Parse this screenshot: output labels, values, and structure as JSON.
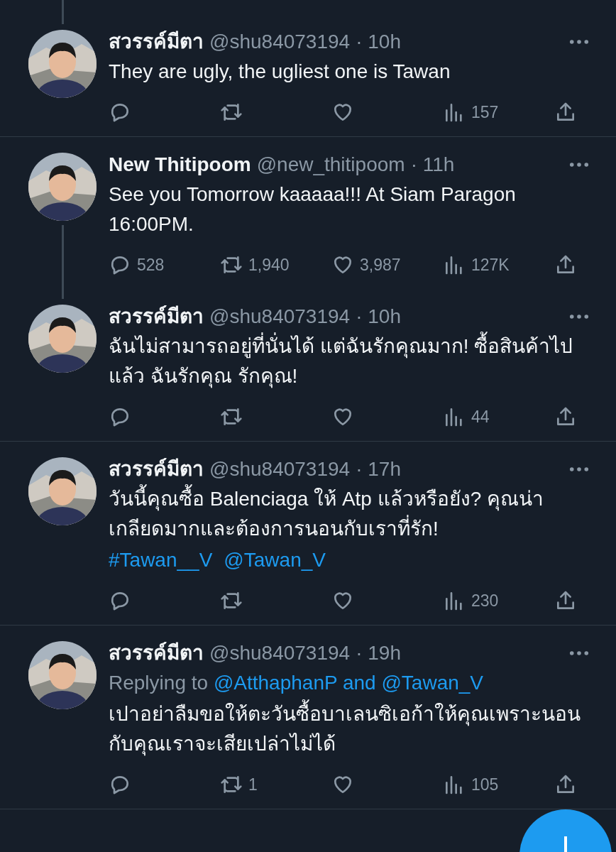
{
  "tweets": [
    {
      "name": "สวรรค์มีตา",
      "handle": "@shu84073194",
      "time": "· 10h",
      "avatar": {
        "kind": "picture"
      },
      "thread_above": true,
      "thread_below": false,
      "divider": true,
      "body": [
        [
          {
            "kind": "text",
            "text": "They are ugly, the ugliest one is Tawan"
          }
        ]
      ],
      "counts": {
        "views": "157"
      }
    },
    {
      "name": "New Thitipoom",
      "handle": "@new_thitipoom",
      "time": "· 11h",
      "avatar": {
        "kind": "picture"
      },
      "thread_above": false,
      "thread_below": true,
      "divider": false,
      "body": [
        [
          {
            "kind": "text",
            "text": "See you Tomorrow kaaaaa!!! At Siam Paragon 16:00PM."
          }
        ]
      ],
      "counts": {
        "reply": "528",
        "retweet": "1,940",
        "like": "3,987",
        "views": "127K"
      }
    },
    {
      "name": "สวรรค์มีตา",
      "handle": "@shu84073194",
      "time": "· 10h",
      "avatar": {
        "kind": "picture"
      },
      "thread_above": true,
      "thread_below": false,
      "divider": true,
      "body": [
        [
          {
            "kind": "text",
            "text": "ฉันไม่สามารถอยู่ที่นั่นได้ แต่ฉันรักคุณมาก!  ซื้อสินค้าไปแล้ว ฉันรักคุณ รักคุณ!"
          }
        ]
      ],
      "counts": {
        "views": "44"
      }
    },
    {
      "name": "สวรรค์มีตา",
      "handle": "@shu84073194",
      "time": "· 17h",
      "avatar": {
        "kind": "picture"
      },
      "thread_above": false,
      "thread_below": false,
      "divider": true,
      "body": [
        [
          {
            "kind": "text",
            "text": "วันนี้คุณซื้อ Balenciaga ให้ Atp แล้วหรือยัง?  คุณน่าเกลียดมากและต้องการนอนกับเราที่รัก!"
          }
        ],
        [
          {
            "kind": "hashtag",
            "text": "#Tawan__V"
          },
          {
            "kind": "mention",
            "text": "@Tawan_V"
          }
        ]
      ],
      "counts": {
        "views": "230"
      }
    },
    {
      "name": "สวรรค์มีตา",
      "handle": "@shu84073194",
      "time": "· 19h",
      "avatar": {
        "kind": "picture"
      },
      "thread_above": false,
      "thread_below": false,
      "divider": true,
      "replying": {
        "prefix": "Replying to",
        "link": "@AtthaphanP and @Tawan_V"
      },
      "body": [
        [
          {
            "kind": "text",
            "text": "เปาอย่าลืมขอให้ตะวันซื้อบาเลนซิเอก้าให้คุณเพราะนอนกับคุณเราจะเสียเปล่าไม่ได้"
          }
        ]
      ],
      "counts": {
        "retweet": "1",
        "views": "105"
      }
    }
  ],
  "compose_button": {
    "visible": true
  }
}
